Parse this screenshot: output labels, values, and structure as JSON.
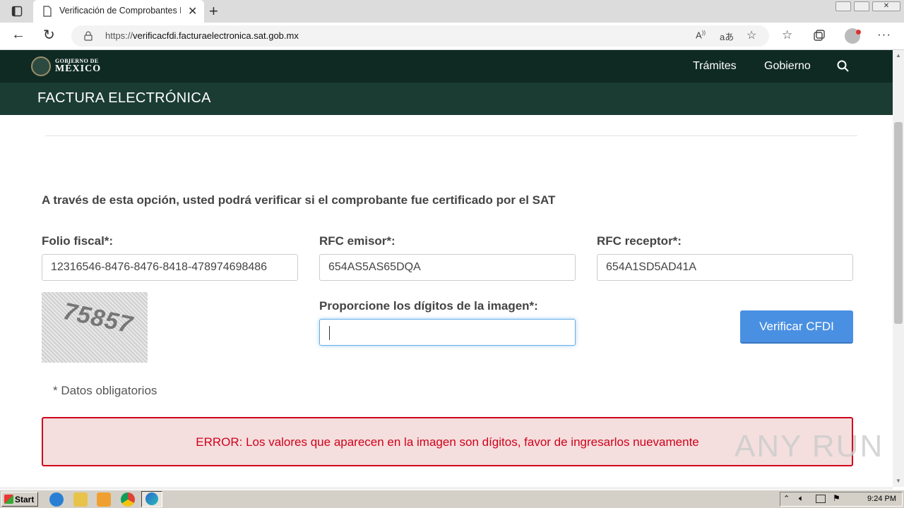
{
  "browser": {
    "tab_title": "Verificación de Comprobantes Fi",
    "url_prefix": "https://",
    "url_host": "verificacfdi.facturaelectronica.sat.gob.mx"
  },
  "site": {
    "logo_line1": "GOBIERNO DE",
    "logo_line2": "MÉXICO",
    "nav": [
      "Trámites",
      "Gobierno"
    ],
    "section_title": "FACTURA ELECTRÓNICA"
  },
  "form": {
    "intro": "A través de esta opción, usted podrá verificar si el comprobante fue certificado por el SAT",
    "folio_label": "Folio fiscal*:",
    "folio_value": "12316546-8476-8476-8418-478974698486",
    "rfc_emisor_label": "RFC emisor*:",
    "rfc_emisor_value": "654AS5AS65DQA",
    "rfc_receptor_label": "RFC receptor*:",
    "rfc_receptor_value": "654A1SD5AD41A",
    "captcha_text": "75857",
    "digits_label": "Proporcione los dígitos de la imagen*:",
    "digits_value": "",
    "submit_label": "Verificar CFDI",
    "required_note": "* Datos obligatorios",
    "error": "ERROR: Los valores que aparecen en la imagen son dígitos, favor de ingresarlos nuevamente"
  },
  "watermark": "ANY RUN",
  "taskbar": {
    "start_label": "Start",
    "clock": "9:24 PM"
  },
  "colors": {
    "header_dark": "#0f2a23",
    "header_green": "#1b3c33",
    "button_blue": "#4a90e2",
    "error_red": "#d0021b"
  }
}
